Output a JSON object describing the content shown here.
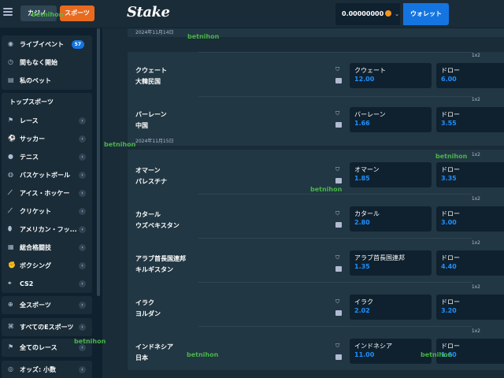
{
  "header": {
    "casino_label": "カジノ",
    "sports_label": "スポーツ",
    "logo": "Stake",
    "balance": "0.00000000",
    "wallet_label": "ウォレット"
  },
  "sidebar": {
    "top_items": [
      {
        "label": "ライブイベント",
        "icon": "live-icon",
        "badge": "57"
      },
      {
        "label": "間もなく開始",
        "icon": "clock-icon"
      },
      {
        "label": "私のベット",
        "icon": "bets-icon"
      }
    ],
    "top_sports_heading": "トップスポーツ",
    "sports": [
      {
        "label": "レース",
        "icon": "racing-icon"
      },
      {
        "label": "サッカー",
        "icon": "soccer-icon"
      },
      {
        "label": "テニス",
        "icon": "tennis-icon"
      },
      {
        "label": "バスケットボール",
        "icon": "basketball-icon"
      },
      {
        "label": "アイス・ホッケー",
        "icon": "hockey-icon"
      },
      {
        "label": "クリケット",
        "icon": "cricket-icon"
      },
      {
        "label": "アメリカン・フッ...",
        "icon": "football-icon"
      },
      {
        "label": "総合格闘技",
        "icon": "mma-icon"
      },
      {
        "label": "ボクシング",
        "icon": "boxing-icon"
      },
      {
        "label": "CS2",
        "icon": "cs2-icon"
      }
    ],
    "all_sports": "全スポーツ",
    "all_esports": "すべてのEスポーツ",
    "all_races": "全てのレース",
    "odds_format": "オッズ: 小数"
  },
  "dates": [
    "2024年11月14日",
    "2024年11月15日"
  ],
  "market_label": "1x2",
  "events": [
    {
      "home": "クウェート",
      "away": "大韓民国",
      "home_odds": "12.00",
      "draw_label": "ドロー",
      "draw_odds": "6.00"
    },
    {
      "home": "バーレーン",
      "away": "中国",
      "home_odds": "1.66",
      "draw_label": "ドロー",
      "draw_odds": "3.55"
    },
    {
      "home": "オマーン",
      "away": "パレスチナ",
      "home_odds": "1.85",
      "draw_label": "ドロー",
      "draw_odds": "3.35"
    },
    {
      "home": "カタール",
      "away": "ウズベキスタン",
      "home_odds": "2.80",
      "draw_label": "ドロー",
      "draw_odds": "3.00"
    },
    {
      "home": "アラブ首長国連邦",
      "away": "キルギスタン",
      "home_odds": "1.35",
      "draw_label": "ドロー",
      "draw_odds": "4.40"
    },
    {
      "home": "イラク",
      "away": "ヨルダン",
      "home_odds": "2.02",
      "draw_label": "ドロー",
      "draw_odds": "3.20"
    },
    {
      "home": "インドネシア",
      "away": "日本",
      "home_odds": "11.00",
      "draw_label": "ドロー",
      "draw_odds": "1.60"
    }
  ],
  "watermark": "betnihon"
}
